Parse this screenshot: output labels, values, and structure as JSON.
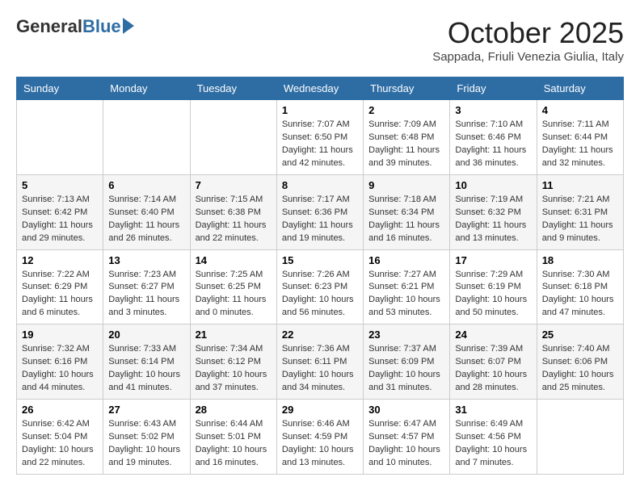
{
  "header": {
    "logo_general": "General",
    "logo_blue": "Blue",
    "month_title": "October 2025",
    "location": "Sappada, Friuli Venezia Giulia, Italy"
  },
  "days_of_week": [
    "Sunday",
    "Monday",
    "Tuesday",
    "Wednesday",
    "Thursday",
    "Friday",
    "Saturday"
  ],
  "weeks": [
    [
      {
        "day": "",
        "sunrise": "",
        "sunset": "",
        "daylight": ""
      },
      {
        "day": "",
        "sunrise": "",
        "sunset": "",
        "daylight": ""
      },
      {
        "day": "",
        "sunrise": "",
        "sunset": "",
        "daylight": ""
      },
      {
        "day": "1",
        "sunrise": "Sunrise: 7:07 AM",
        "sunset": "Sunset: 6:50 PM",
        "daylight": "Daylight: 11 hours and 42 minutes."
      },
      {
        "day": "2",
        "sunrise": "Sunrise: 7:09 AM",
        "sunset": "Sunset: 6:48 PM",
        "daylight": "Daylight: 11 hours and 39 minutes."
      },
      {
        "day": "3",
        "sunrise": "Sunrise: 7:10 AM",
        "sunset": "Sunset: 6:46 PM",
        "daylight": "Daylight: 11 hours and 36 minutes."
      },
      {
        "day": "4",
        "sunrise": "Sunrise: 7:11 AM",
        "sunset": "Sunset: 6:44 PM",
        "daylight": "Daylight: 11 hours and 32 minutes."
      }
    ],
    [
      {
        "day": "5",
        "sunrise": "Sunrise: 7:13 AM",
        "sunset": "Sunset: 6:42 PM",
        "daylight": "Daylight: 11 hours and 29 minutes."
      },
      {
        "day": "6",
        "sunrise": "Sunrise: 7:14 AM",
        "sunset": "Sunset: 6:40 PM",
        "daylight": "Daylight: 11 hours and 26 minutes."
      },
      {
        "day": "7",
        "sunrise": "Sunrise: 7:15 AM",
        "sunset": "Sunset: 6:38 PM",
        "daylight": "Daylight: 11 hours and 22 minutes."
      },
      {
        "day": "8",
        "sunrise": "Sunrise: 7:17 AM",
        "sunset": "Sunset: 6:36 PM",
        "daylight": "Daylight: 11 hours and 19 minutes."
      },
      {
        "day": "9",
        "sunrise": "Sunrise: 7:18 AM",
        "sunset": "Sunset: 6:34 PM",
        "daylight": "Daylight: 11 hours and 16 minutes."
      },
      {
        "day": "10",
        "sunrise": "Sunrise: 7:19 AM",
        "sunset": "Sunset: 6:32 PM",
        "daylight": "Daylight: 11 hours and 13 minutes."
      },
      {
        "day": "11",
        "sunrise": "Sunrise: 7:21 AM",
        "sunset": "Sunset: 6:31 PM",
        "daylight": "Daylight: 11 hours and 9 minutes."
      }
    ],
    [
      {
        "day": "12",
        "sunrise": "Sunrise: 7:22 AM",
        "sunset": "Sunset: 6:29 PM",
        "daylight": "Daylight: 11 hours and 6 minutes."
      },
      {
        "day": "13",
        "sunrise": "Sunrise: 7:23 AM",
        "sunset": "Sunset: 6:27 PM",
        "daylight": "Daylight: 11 hours and 3 minutes."
      },
      {
        "day": "14",
        "sunrise": "Sunrise: 7:25 AM",
        "sunset": "Sunset: 6:25 PM",
        "daylight": "Daylight: 11 hours and 0 minutes."
      },
      {
        "day": "15",
        "sunrise": "Sunrise: 7:26 AM",
        "sunset": "Sunset: 6:23 PM",
        "daylight": "Daylight: 10 hours and 56 minutes."
      },
      {
        "day": "16",
        "sunrise": "Sunrise: 7:27 AM",
        "sunset": "Sunset: 6:21 PM",
        "daylight": "Daylight: 10 hours and 53 minutes."
      },
      {
        "day": "17",
        "sunrise": "Sunrise: 7:29 AM",
        "sunset": "Sunset: 6:19 PM",
        "daylight": "Daylight: 10 hours and 50 minutes."
      },
      {
        "day": "18",
        "sunrise": "Sunrise: 7:30 AM",
        "sunset": "Sunset: 6:18 PM",
        "daylight": "Daylight: 10 hours and 47 minutes."
      }
    ],
    [
      {
        "day": "19",
        "sunrise": "Sunrise: 7:32 AM",
        "sunset": "Sunset: 6:16 PM",
        "daylight": "Daylight: 10 hours and 44 minutes."
      },
      {
        "day": "20",
        "sunrise": "Sunrise: 7:33 AM",
        "sunset": "Sunset: 6:14 PM",
        "daylight": "Daylight: 10 hours and 41 minutes."
      },
      {
        "day": "21",
        "sunrise": "Sunrise: 7:34 AM",
        "sunset": "Sunset: 6:12 PM",
        "daylight": "Daylight: 10 hours and 37 minutes."
      },
      {
        "day": "22",
        "sunrise": "Sunrise: 7:36 AM",
        "sunset": "Sunset: 6:11 PM",
        "daylight": "Daylight: 10 hours and 34 minutes."
      },
      {
        "day": "23",
        "sunrise": "Sunrise: 7:37 AM",
        "sunset": "Sunset: 6:09 PM",
        "daylight": "Daylight: 10 hours and 31 minutes."
      },
      {
        "day": "24",
        "sunrise": "Sunrise: 7:39 AM",
        "sunset": "Sunset: 6:07 PM",
        "daylight": "Daylight: 10 hours and 28 minutes."
      },
      {
        "day": "25",
        "sunrise": "Sunrise: 7:40 AM",
        "sunset": "Sunset: 6:06 PM",
        "daylight": "Daylight: 10 hours and 25 minutes."
      }
    ],
    [
      {
        "day": "26",
        "sunrise": "Sunrise: 6:42 AM",
        "sunset": "Sunset: 5:04 PM",
        "daylight": "Daylight: 10 hours and 22 minutes."
      },
      {
        "day": "27",
        "sunrise": "Sunrise: 6:43 AM",
        "sunset": "Sunset: 5:02 PM",
        "daylight": "Daylight: 10 hours and 19 minutes."
      },
      {
        "day": "28",
        "sunrise": "Sunrise: 6:44 AM",
        "sunset": "Sunset: 5:01 PM",
        "daylight": "Daylight: 10 hours and 16 minutes."
      },
      {
        "day": "29",
        "sunrise": "Sunrise: 6:46 AM",
        "sunset": "Sunset: 4:59 PM",
        "daylight": "Daylight: 10 hours and 13 minutes."
      },
      {
        "day": "30",
        "sunrise": "Sunrise: 6:47 AM",
        "sunset": "Sunset: 4:57 PM",
        "daylight": "Daylight: 10 hours and 10 minutes."
      },
      {
        "day": "31",
        "sunrise": "Sunrise: 6:49 AM",
        "sunset": "Sunset: 4:56 PM",
        "daylight": "Daylight: 10 hours and 7 minutes."
      },
      {
        "day": "",
        "sunrise": "",
        "sunset": "",
        "daylight": ""
      }
    ]
  ]
}
